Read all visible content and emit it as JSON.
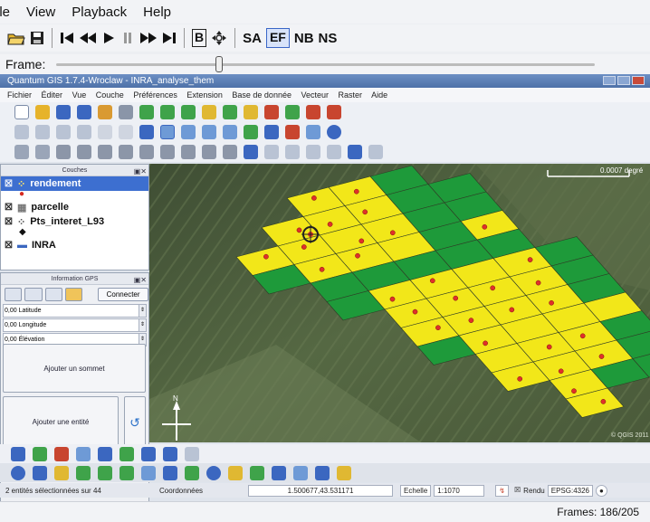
{
  "player": {
    "menu": [
      "ile",
      "View",
      "Playback",
      "Help"
    ],
    "toolbar": {
      "box_b": "B",
      "sa": "SA",
      "ef": "EF",
      "nb": "NB",
      "ns": "NS"
    },
    "frame_label": "Frame:",
    "frame_position": 0.3,
    "frames_status": "Frames: 186/205"
  },
  "qgis": {
    "window_title": "Quantum GIS 1.7.4-Wroclaw - INRA_analyse_them",
    "menu": [
      "Fichier",
      "Éditer",
      "Vue",
      "Couche",
      "Préférences",
      "Extension",
      "Base de donnée",
      "Vecteur",
      "Raster",
      "Aide"
    ],
    "layers_panel": {
      "title": "Couches",
      "items": [
        {
          "label": "rendement",
          "selected": true
        },
        {
          "label": "parcelle",
          "selected": false
        },
        {
          "label": "Pts_interet_L93",
          "selected": false
        },
        {
          "label": "INRA",
          "selected": false
        }
      ]
    },
    "gps_panel": {
      "title": "Information GPS",
      "connect": "Connecter",
      "fields": [
        "0,00 Latitude",
        "0,00 Longitude",
        "0,00 Élévation"
      ],
      "add_vertex": "Ajouter un sommet",
      "add_feature": "Ajouter une entité"
    },
    "map": {
      "scale_bar_label": "0.0007 degré",
      "copyright": "© QGIS 2011",
      "north_label": "N",
      "colors": {
        "yellow": "#f2e719",
        "green": "#1e9a3a",
        "point": "#e0302a"
      }
    },
    "status": {
      "selected": "2 entités sélectionnées sur 44",
      "coordinates_label": "Coordonnées",
      "coordinates": "1.500677,43.531171",
      "scale_label": "Echelle",
      "scale": "1:1070",
      "render": "Rendu",
      "epsg": "EPSG:4326"
    }
  }
}
